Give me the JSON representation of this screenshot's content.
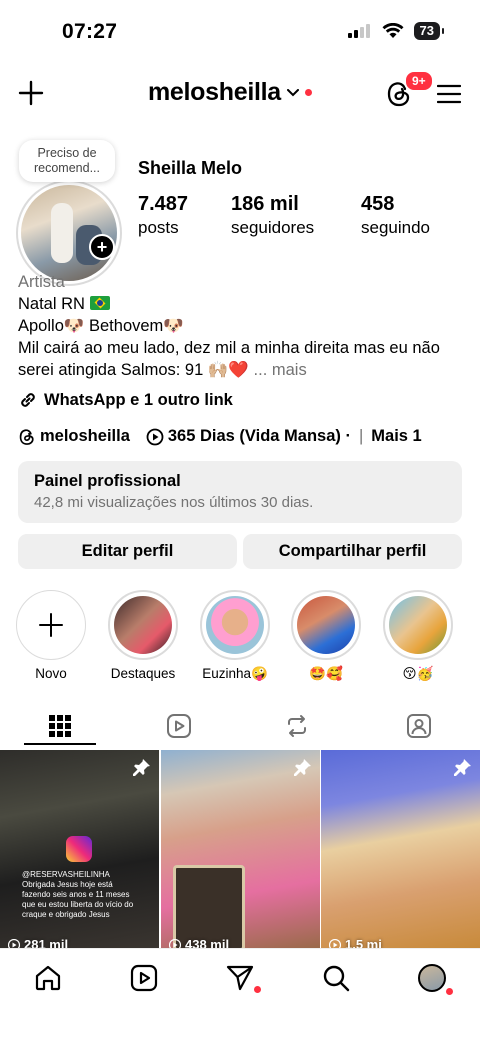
{
  "status_bar": {
    "time": "07:27",
    "battery": "73"
  },
  "header": {
    "username": "melosheilla",
    "notifications_badge": "9+"
  },
  "profile": {
    "note": "Preciso de recomend...",
    "full_name": "Sheilla Melo",
    "stats": [
      {
        "value": "7.487",
        "label": "posts"
      },
      {
        "value": "186 mil",
        "label": "seguidores"
      },
      {
        "value": "458",
        "label": "seguindo"
      }
    ],
    "category": "Artista",
    "bio_line1": "Natal RN",
    "bio_line2": " Apollo🐶 Bethovem🐶",
    "bio_line3": " Mil cairá ao meu lado, dez mil a minha direita mas eu não serei atingida Salmos: 91 🙌🏼❤️",
    "bio_more": "... mais",
    "links": "WhatsApp e 1 outro link",
    "threads_handle": "melosheilla",
    "music": "365 Dias (Vida Mansa) · ",
    "more_label": "Mais 1"
  },
  "pro_panel": {
    "title": "Painel profissional",
    "subtitle": "42,8 mi visualizações nos últimos 30 dias."
  },
  "buttons": {
    "edit": "Editar perfil",
    "share": "Compartilhar perfil"
  },
  "highlights": [
    {
      "label": "Novo"
    },
    {
      "label": "Destaques"
    },
    {
      "label": "Euzinha🤪"
    },
    {
      "label": "🤩🥰"
    },
    {
      "label": "😚🥳"
    }
  ],
  "posts": [
    {
      "views": "281 mil",
      "pinned": true,
      "caption": "@RESERVASHEILINHA\nObrigada Jesus hoje está fazendo seis anos e 11 meses que eu estou liberta do vício do craque e obrigado Jesus"
    },
    {
      "views": "438 mil",
      "pinned": true
    },
    {
      "views": "1,5 mi",
      "pinned": true
    }
  ],
  "colors": {
    "accent_red": "#ff3040",
    "muted": "#737373",
    "panel_bg": "#efefef"
  }
}
